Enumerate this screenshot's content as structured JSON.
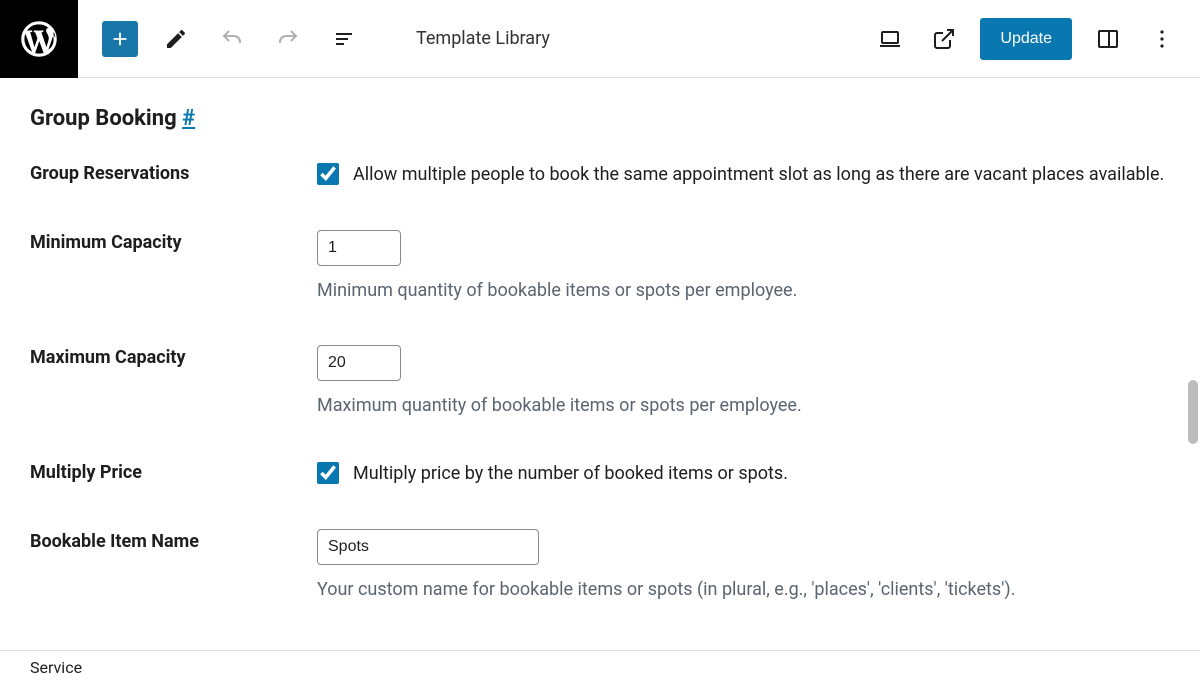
{
  "topbar": {
    "title": "Template Library",
    "update_label": "Update"
  },
  "section": {
    "title": "Group Booking",
    "hash": "#"
  },
  "rows": {
    "reservations": {
      "label": "Group Reservations",
      "checked": true,
      "text": "Allow multiple people to book the same appointment slot as long as there are vacant places available."
    },
    "min_cap": {
      "label": "Minimum Capacity",
      "value": "1",
      "help": "Minimum quantity of bookable items or spots per employee."
    },
    "max_cap": {
      "label": "Maximum Capacity",
      "value": "20",
      "help": "Maximum quantity of bookable items or spots per employee."
    },
    "multiply": {
      "label": "Multiply Price",
      "checked": true,
      "text": "Multiply price by the number of booked items or spots."
    },
    "item_name": {
      "label": "Bookable Item Name",
      "value": "Spots",
      "help": "Your custom name for bookable items or spots (in plural, e.g., 'places', 'clients', 'tickets')."
    }
  },
  "footer": {
    "breadcrumb": "Service"
  }
}
